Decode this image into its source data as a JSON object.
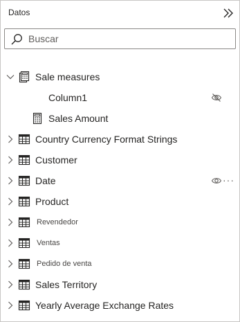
{
  "pane": {
    "title": "Datos",
    "collapse_icon": "double-chevron-right-icon"
  },
  "search": {
    "placeholder": "Buscar",
    "value": ""
  },
  "tree": {
    "sale_measures": {
      "label": "Sale measures",
      "expanded": true
    },
    "column1": {
      "label": "Column1",
      "hidden_icon": "eye-hidden-icon"
    },
    "sales_amount": {
      "label": "Sales Amount"
    },
    "country_currency": {
      "label": "Country Currency Format Strings"
    },
    "customer": {
      "label": "Customer"
    },
    "date": {
      "label": "Date",
      "visibility_icon": "eye-icon",
      "more_label": "···"
    },
    "product": {
      "label": "Product"
    },
    "revendedor": {
      "label": "Revendedor"
    },
    "ventas": {
      "label": "Ventas"
    },
    "pedido_de_venta": {
      "label": "Pedido de venta"
    },
    "sales_territory": {
      "label": "Sales Territory"
    },
    "yearly_average": {
      "label": "Yearly Average Exchange Rates"
    }
  }
}
